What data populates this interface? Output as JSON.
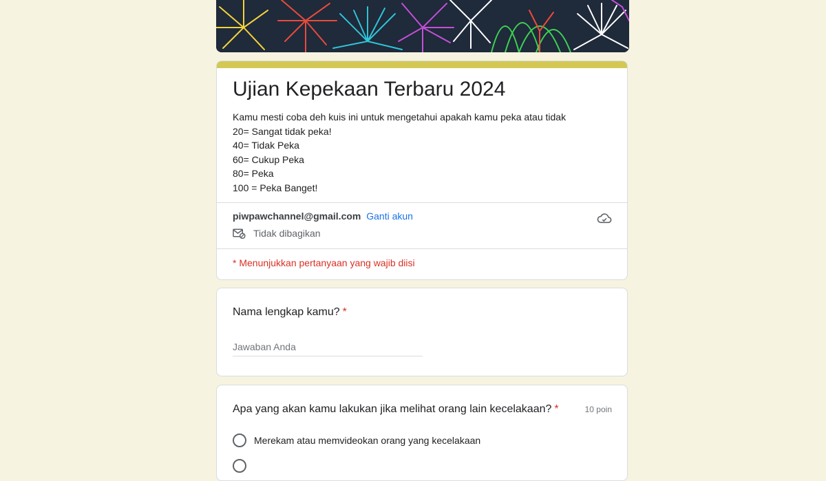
{
  "form": {
    "title": "Ujian Kepekaan Terbaru 2024",
    "description": [
      "Kamu mesti coba deh kuis ini untuk mengetahui apakah kamu peka atau tidak",
      "20= Sangat tidak peka!",
      "40= Tidak Peka",
      "60= Cukup Peka",
      "80= Peka",
      "100 = Peka Banget!"
    ],
    "account_email": "piwpawchannel@gmail.com",
    "switch_account": "Ganti akun",
    "not_shared": "Tidak dibagikan",
    "required_note": "* Menunjukkan pertanyaan yang wajib diisi"
  },
  "questions": [
    {
      "title": "Nama lengkap kamu?",
      "required_mark": "*",
      "placeholder": "Jawaban Anda"
    },
    {
      "title": "Apa yang akan kamu lakukan jika melihat orang lain kecelakaan?",
      "required_mark": "*",
      "points": "10 poin",
      "options": [
        "Merekam atau memvideokan orang yang kecelakaan",
        ""
      ]
    }
  ],
  "colors": {
    "page_background": "#f6f3e0",
    "theme_accent": "#d3c853",
    "required": "#d93025",
    "link": "#1a73e8"
  },
  "icons": [
    "cloud-icon",
    "mail-off-icon",
    "radio-icon"
  ]
}
